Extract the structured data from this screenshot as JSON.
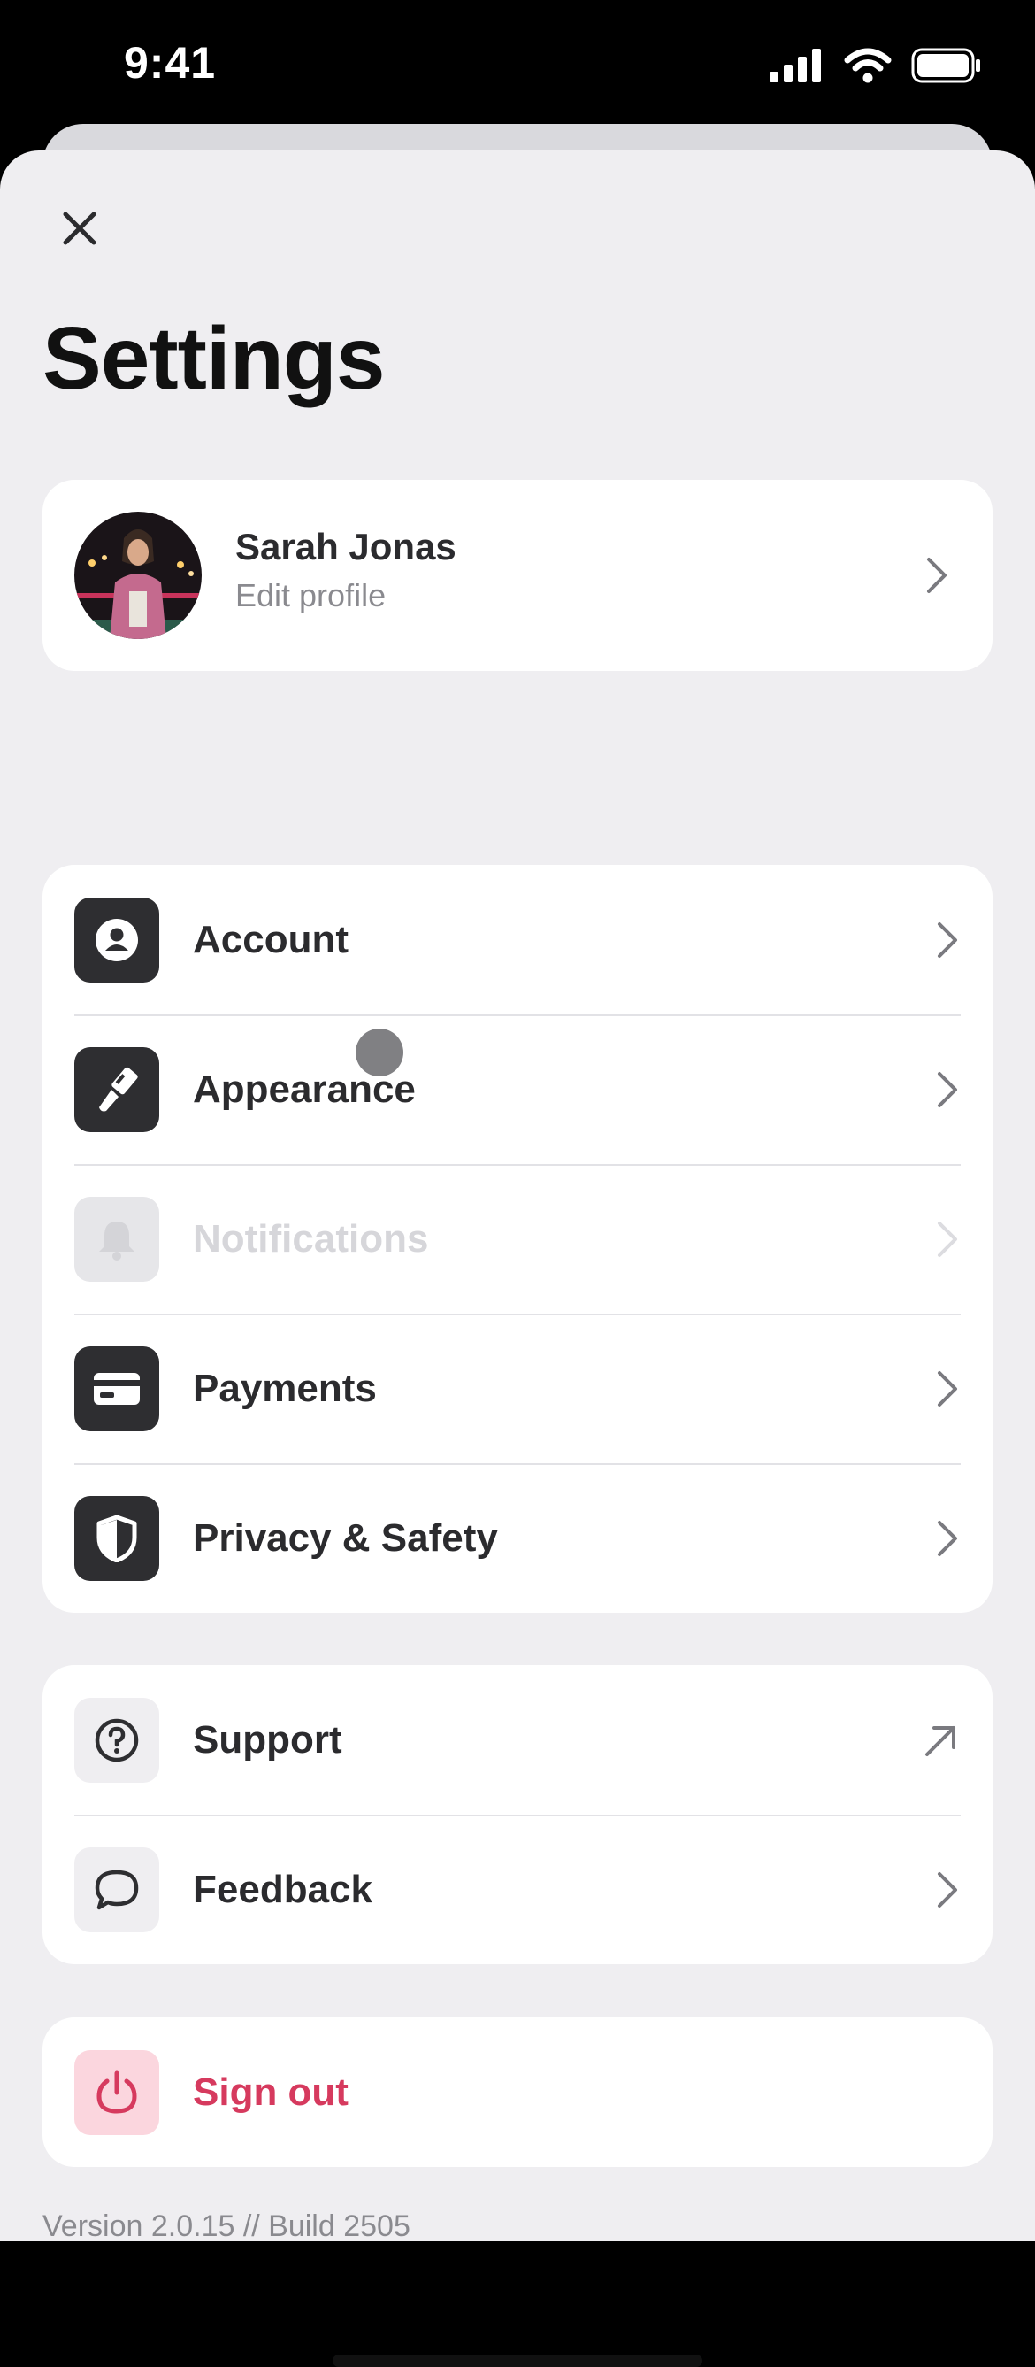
{
  "status_bar": {
    "time": "9:41"
  },
  "header": {
    "title": "Settings"
  },
  "profile": {
    "name": "Sarah Jonas",
    "subtitle": "Edit profile"
  },
  "settings_items": [
    {
      "label": "Account",
      "icon": "person-icon"
    },
    {
      "label": "Appearance",
      "icon": "paintbrush-icon"
    },
    {
      "label": "Notifications",
      "icon": "bell-icon",
      "state": "disabled"
    },
    {
      "label": "Payments",
      "icon": "credit-card-icon"
    },
    {
      "label": "Privacy & Safety",
      "icon": "shield-icon"
    }
  ],
  "support_items": [
    {
      "label": "Support",
      "icon": "question-icon",
      "trailing": "external-arrow-icon"
    },
    {
      "label": "Feedback",
      "icon": "speech-bubble-icon",
      "trailing": "chevron-right-icon"
    }
  ],
  "sign_out": {
    "label": "Sign out",
    "icon": "power-icon"
  },
  "footer": {
    "version": "Version 2.0.15 // Build 2505"
  },
  "colors": {
    "danger": "#d63a5e",
    "background": "#efeef1",
    "tile_dark": "#2e2e31"
  }
}
